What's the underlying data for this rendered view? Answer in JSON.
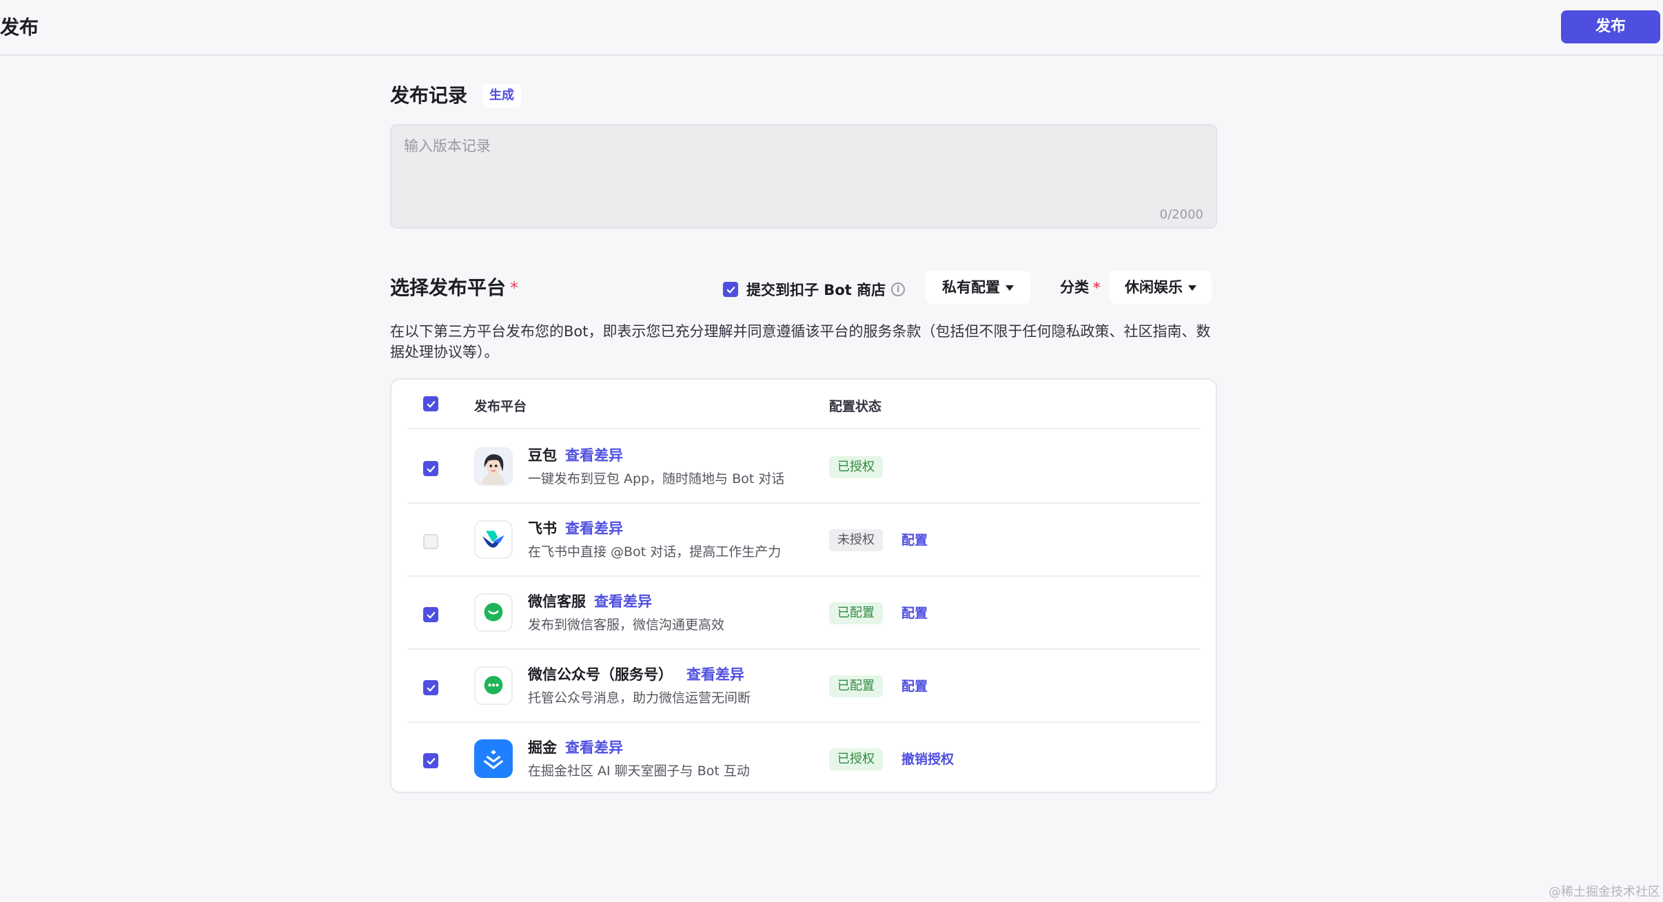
{
  "header": {
    "title": "发布",
    "publish_label": "发布"
  },
  "release_notes": {
    "title": "发布记录",
    "generate_label": "生成",
    "placeholder": "输入版本记录",
    "value": "",
    "counter": "0/2000"
  },
  "platforms_section": {
    "title": "选择发布平台",
    "required_mark": "*",
    "bot_store_label": "提交到扣子 Bot 商店",
    "bot_store_checked": true,
    "privacy_dropdown": "私有配置",
    "category_label": "分类",
    "category_required_mark": "*",
    "category_value": "休闲娱乐",
    "disclaimer": "在以下第三方平台发布您的Bot，即表示您已充分理解并同意遵循该平台的服务条款（包括但不限于任何隐私政策、社区指南、数据处理协议等）。"
  },
  "table": {
    "headers": {
      "platform": "发布平台",
      "status": "配置状态"
    },
    "all_checked": true,
    "rows": [
      {
        "name": "豆包",
        "diff": "查看差异",
        "desc": "一键发布到豆包 App，随时随地与 Bot 对话",
        "status": "已授权",
        "status_type": "green",
        "action": "",
        "checked": true,
        "icon": "doubao-avatar-icon"
      },
      {
        "name": "飞书",
        "diff": "查看差异",
        "desc": "在飞书中直接 @Bot 对话，提高工作生产力",
        "status": "未授权",
        "status_type": "gray",
        "action": "配置",
        "checked": false,
        "icon": "feishu-icon"
      },
      {
        "name": "微信客服",
        "diff": "查看差异",
        "desc": "发布到微信客服，微信沟通更高效",
        "status": "已配置",
        "status_type": "green",
        "action": "配置",
        "checked": true,
        "icon": "wechat-service-icon"
      },
      {
        "name": "微信公众号（服务号）",
        "diff": "查看差异",
        "desc": "托管公众号消息，助力微信运营无间断",
        "status": "已配置",
        "status_type": "green",
        "action": "配置",
        "checked": true,
        "icon": "wechat-official-icon"
      },
      {
        "name": "掘金",
        "diff": "查看差异",
        "desc": "在掘金社区 AI 聊天室圈子与 Bot 互动",
        "status": "已授权",
        "status_type": "green",
        "action": "撤销授权",
        "checked": true,
        "icon": "juejin-icon"
      }
    ]
  },
  "watermark": "@稀土掘金技术社区",
  "colors": {
    "accent": "#4e4fe0",
    "required": "#f0435c",
    "badge_green_bg": "#e6f6e8",
    "badge_green_text": "#2f8a3f"
  }
}
